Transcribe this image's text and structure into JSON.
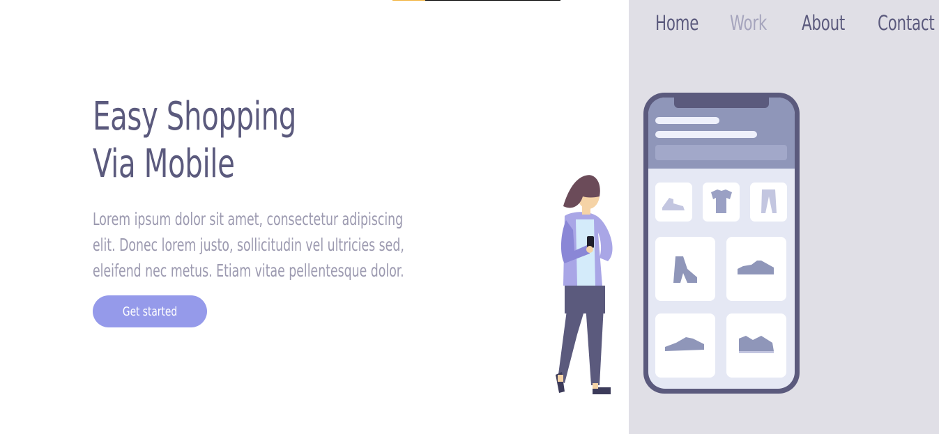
{
  "nav": {
    "items": [
      {
        "label": "Home",
        "active": false
      },
      {
        "label": "Work",
        "active": true
      },
      {
        "label": "About",
        "active": false
      },
      {
        "label": "Contact",
        "active": false
      }
    ]
  },
  "hero": {
    "title_line1": "Easy Shopping",
    "title_line2": "Via Mobile",
    "description_lines": [
      "Lorem ipsum dolor sit amet, consectetur adipiscing",
      "elit. Donec lorem justo, sollicitudin vel ultricies sed,",
      "eleifend nec metus. Etiam vitae pellentesque dolor."
    ],
    "cta_label": "Get started"
  },
  "colors": {
    "text_primary": "#5b5a7d",
    "text_muted": "#9c9ab0",
    "nav_active": "#a6a5bd",
    "button": "#959aea",
    "panel_bg": "#e0dfe6",
    "phone_frame": "#5b5a7d",
    "accent_stripe": "#f2b33d"
  },
  "illustration": {
    "phone_products": [
      "sneaker-icon",
      "tshirt-icon",
      "pants-icon",
      "boot-icon",
      "running-shoe-icon",
      "flat-shoe-icon",
      "trainer-icon"
    ]
  }
}
